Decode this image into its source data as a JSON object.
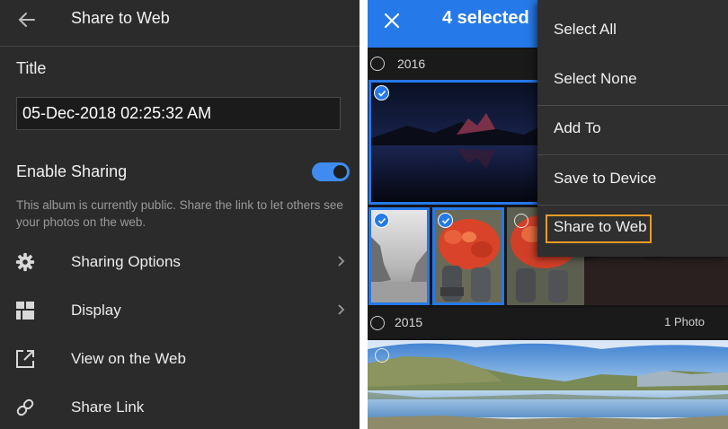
{
  "left_panel": {
    "header_title": "Share to Web",
    "title_label": "Title",
    "title_value": "05-Dec-2018 02:25:32 AM",
    "enable_sharing_label": "Enable Sharing",
    "enable_sharing_on": true,
    "description": "This album is currently public. Share the link to let others see your photos on the web.",
    "rows": [
      {
        "label": "Sharing Options",
        "icon": "gear-icon",
        "has_chevron": true
      },
      {
        "label": "Display",
        "icon": "grid-layout-icon",
        "has_chevron": true
      },
      {
        "label": "View on the Web",
        "icon": "external-link-icon",
        "has_chevron": false
      },
      {
        "label": "Share Link",
        "icon": "link-icon",
        "has_chevron": false
      }
    ]
  },
  "right_panel": {
    "selected_count_text": "4 selected",
    "sections": [
      {
        "year": "2016",
        "count_text": ""
      },
      {
        "year": "2015",
        "count_text": "1 Photo"
      }
    ],
    "menu_items": [
      "Select All",
      "Select None",
      "Add To",
      "Save to Device",
      "Share to Web"
    ],
    "highlighted_menu_item": "Share to Web"
  },
  "colors": {
    "accent_blue": "#2679e8",
    "highlight_orange": "#f09a27",
    "panel_dark": "#2b2b2b"
  }
}
